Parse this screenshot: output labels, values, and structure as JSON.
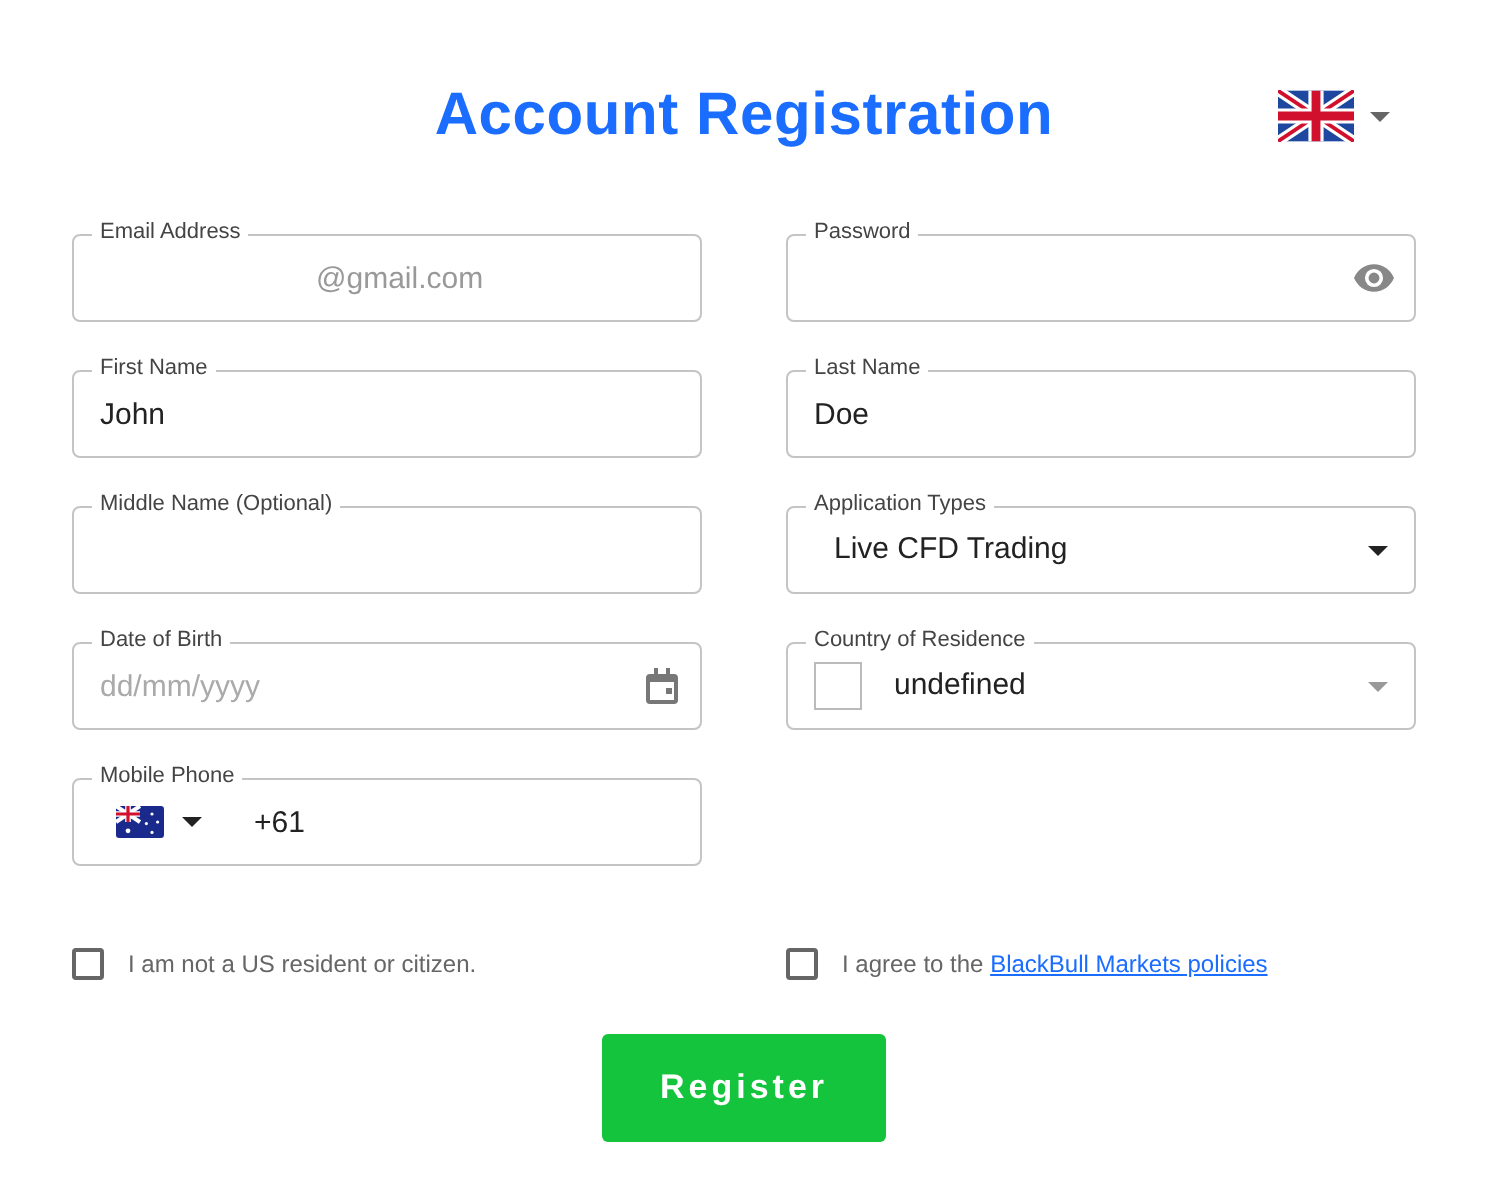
{
  "title": "Account Registration",
  "fields": [
    {
      "kind": "text",
      "label": "Email Address",
      "value": "@gmail.com"
    },
    {
      "kind": "password",
      "label": "Password"
    },
    {
      "kind": "text",
      "label": "First Name",
      "value": "John"
    },
    {
      "kind": "text",
      "label": "Last Name",
      "value": "Doe"
    },
    {
      "kind": "text",
      "label": "Middle Name (Optional)"
    },
    {
      "kind": "select",
      "label": "Application Types",
      "value": "Live CFD Trading"
    },
    {
      "kind": "date",
      "label": "Date of Birth",
      "placeholder": "dd/mm/yyyy"
    },
    {
      "kind": "country",
      "label": "Country of Residence",
      "value": "undefined"
    },
    {
      "kind": "phone",
      "label": "Mobile Phone",
      "value": "+61"
    }
  ],
  "checkboxes": [
    {
      "label": "I am not a US resident or citizen.",
      "checked": false
    },
    {
      "label": "I agree to the",
      "link": "BlackBull Markets policies",
      "checked": false
    }
  ],
  "button": "Register"
}
